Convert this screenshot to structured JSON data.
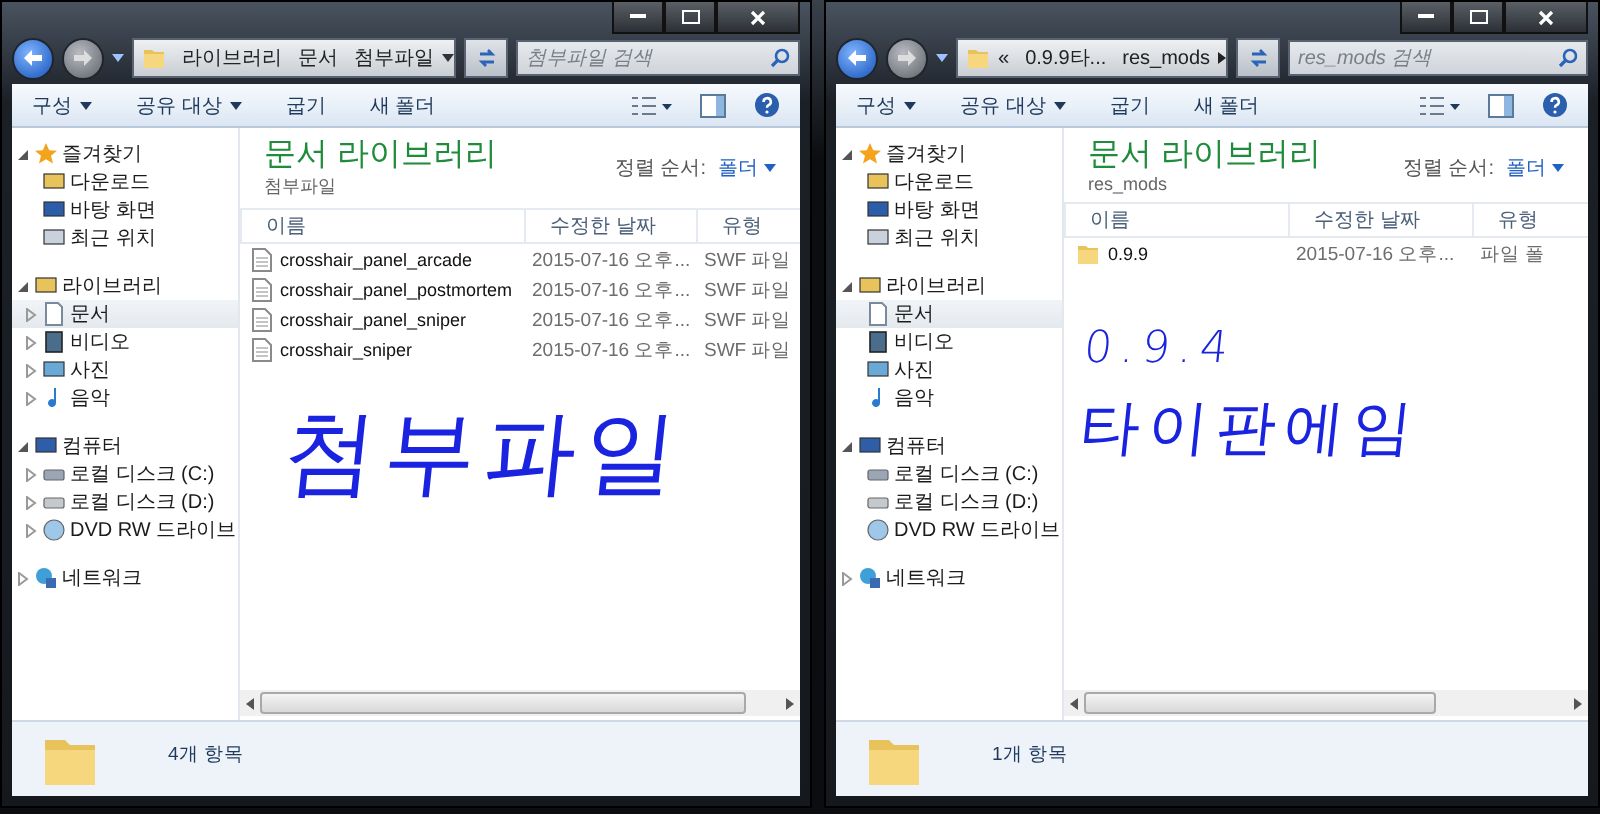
{
  "windows": [
    {
      "address": {
        "crumbs": [
          "라이브러리",
          "문서",
          "첨부파일"
        ],
        "trailing_separator": false
      },
      "search": {
        "placeholder": "첨부파일 검색"
      },
      "toolbar": [
        {
          "label": "구성",
          "dropdown": true
        },
        {
          "label": "공유 대상",
          "dropdown": true
        },
        {
          "label": "굽기",
          "dropdown": false
        },
        {
          "label": "새 폴더",
          "dropdown": false
        }
      ],
      "sidebar": [
        {
          "label": "즐겨찾기",
          "expanded": true,
          "children": [
            {
              "label": "다운로드",
              "selected": false,
              "expandable": false
            },
            {
              "label": "바탕 화면",
              "selected": false,
              "expandable": false
            },
            {
              "label": "최근 위치",
              "selected": false,
              "expandable": false
            }
          ]
        },
        {
          "label": "라이브러리",
          "expanded": true,
          "children": [
            {
              "label": "문서",
              "selected": true,
              "expandable": true
            },
            {
              "label": "비디오",
              "selected": false,
              "expandable": true
            },
            {
              "label": "사진",
              "selected": false,
              "expandable": true
            },
            {
              "label": "음악",
              "selected": false,
              "expandable": true
            }
          ]
        },
        {
          "label": "컴퓨터",
          "expanded": true,
          "children": [
            {
              "label": "로컬 디스크 (C:)",
              "selected": false,
              "expandable": true
            },
            {
              "label": "로컬 디스크 (D:)",
              "selected": false,
              "expandable": true
            },
            {
              "label": "DVD RW 드라이브",
              "selected": false,
              "expandable": true
            }
          ]
        },
        {
          "label": "네트워크",
          "expanded": false
        }
      ],
      "library": {
        "title": "문서 라이브러리",
        "subtitle": "첨부파일",
        "sort_label": "정렬 순서:",
        "sort_value": "폴더"
      },
      "columns": [
        "이름",
        "수정한 날짜",
        "유형"
      ],
      "rows": [
        {
          "kind": "file",
          "name": "crosshair_panel_arcade",
          "date": "2015-07-16 오후...",
          "type": "SWF 파일"
        },
        {
          "kind": "file",
          "name": "crosshair_panel_postmortem",
          "date": "2015-07-16 오후...",
          "type": "SWF 파일"
        },
        {
          "kind": "file",
          "name": "crosshair_panel_sniper",
          "date": "2015-07-16 오후...",
          "type": "SWF 파일"
        },
        {
          "kind": "file",
          "name": "crosshair_sniper",
          "date": "2015-07-16 오후...",
          "type": "SWF 파일"
        }
      ],
      "handwriting": [
        "첨부파일"
      ],
      "status": "4개 항목"
    },
    {
      "address": {
        "overflow_mark": "«",
        "crumbs": [
          "0.9.9타...",
          "res_mods"
        ],
        "trailing_separator": true
      },
      "search": {
        "placeholder": "res_mods 검색"
      },
      "toolbar": [
        {
          "label": "구성",
          "dropdown": true
        },
        {
          "label": "공유 대상",
          "dropdown": true
        },
        {
          "label": "굽기",
          "dropdown": false
        },
        {
          "label": "새 폴더",
          "dropdown": false
        }
      ],
      "sidebar": [
        {
          "label": "즐겨찾기",
          "expanded": true,
          "children": [
            {
              "label": "다운로드",
              "selected": false,
              "expandable": false
            },
            {
              "label": "바탕 화면",
              "selected": false,
              "expandable": false
            },
            {
              "label": "최근 위치",
              "selected": false,
              "expandable": false
            }
          ]
        },
        {
          "label": "라이브러리",
          "expanded": true,
          "children": [
            {
              "label": "문서",
              "selected": true,
              "expandable": false
            },
            {
              "label": "비디오",
              "selected": false,
              "expandable": false
            },
            {
              "label": "사진",
              "selected": false,
              "expandable": false
            },
            {
              "label": "음악",
              "selected": false,
              "expandable": false
            }
          ]
        },
        {
          "label": "컴퓨터",
          "expanded": true,
          "children": [
            {
              "label": "로컬 디스크 (C:)",
              "selected": false,
              "expandable": false
            },
            {
              "label": "로컬 디스크 (D:)",
              "selected": false,
              "expandable": false
            },
            {
              "label": "DVD RW 드라이브",
              "selected": false,
              "expandable": false
            }
          ]
        },
        {
          "label": "네트워크",
          "expanded": false
        }
      ],
      "library": {
        "title": "문서 라이브러리",
        "subtitle": "res_mods",
        "sort_label": "정렬 순서:",
        "sort_value": "폴더"
      },
      "columns": [
        "이름",
        "수정한 날짜",
        "유형"
      ],
      "rows": [
        {
          "kind": "folder",
          "name": "0.9.9",
          "date": "2015-07-16 오후...",
          "type": "파일 폴"
        }
      ],
      "handwriting": [
        "0.9.4",
        "타이판에임"
      ],
      "status": "1개 항목"
    }
  ]
}
